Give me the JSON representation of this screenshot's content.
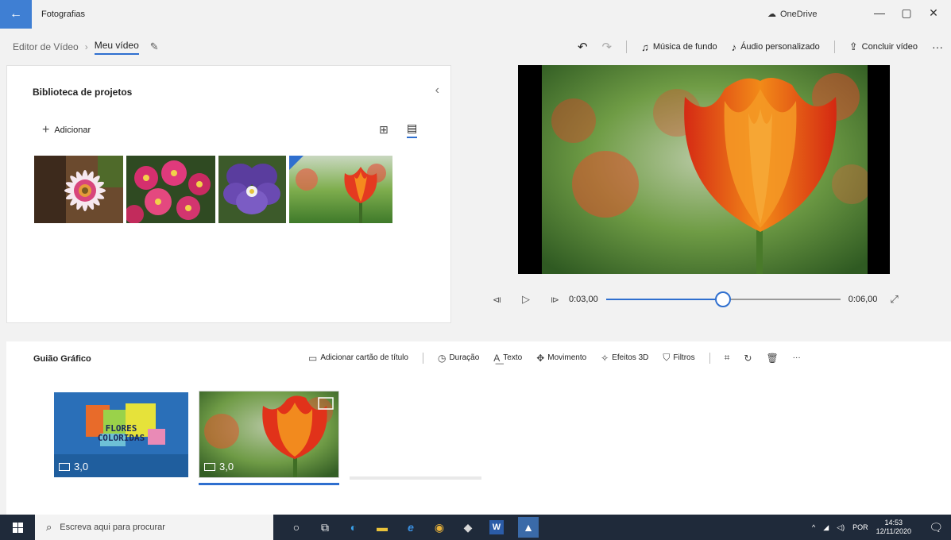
{
  "window": {
    "back_icon": "back-arrow-icon",
    "title": "Fotografias",
    "onedrive_label": "OneDrive",
    "minimize_glyph": "—",
    "maximize_glyph": "▢",
    "close_glyph": "✕"
  },
  "breadcrumb": {
    "parent": "Editor de Vídeo",
    "separator": "›",
    "current": "Meu vídeo"
  },
  "toolbar": {
    "undo_glyph": "↶",
    "redo_glyph": "↷",
    "music_label": "Música de fundo",
    "custom_audio_label": "Áudio personalizado",
    "finish_label": "Concluir vídeo",
    "more_glyph": "···"
  },
  "library": {
    "title": "Biblioteca de projetos",
    "collapse_glyph": "‹",
    "add_label": "Adicionar",
    "grid_glyph": "⊞",
    "list_glyph": "▤",
    "thumbnails": [
      "gerbera",
      "crisantemos",
      "amor-perfeito",
      "tulipa"
    ]
  },
  "player": {
    "prev_glyph": "⧏",
    "play_glyph": "▷",
    "next_glyph": "⧐",
    "current_time": "0:03,00",
    "total_time": "0:06,00",
    "progress": 0.5,
    "expand_glyph": "⤢"
  },
  "storyboard": {
    "title": "Guião Gráfico",
    "tools": {
      "title_card": "Adicionar cartão de título",
      "duration": "Duração",
      "text": "Texto",
      "motion": "Movimento",
      "effects3d": "Efeitos 3D",
      "filters": "Filtros",
      "more": "···"
    },
    "cards": [
      {
        "line1": "FLORES",
        "line2": "COLORIDAS",
        "duration": "3,0"
      },
      {
        "duration": "3,0"
      }
    ]
  },
  "taskbar": {
    "search_placeholder": "Escreva aqui para procurar",
    "lang": "POR",
    "time": "14:53",
    "date": "12/11/2020"
  },
  "colors": {
    "accent": "#2f6fcf",
    "title_card_bg": "#2a6fb8"
  }
}
